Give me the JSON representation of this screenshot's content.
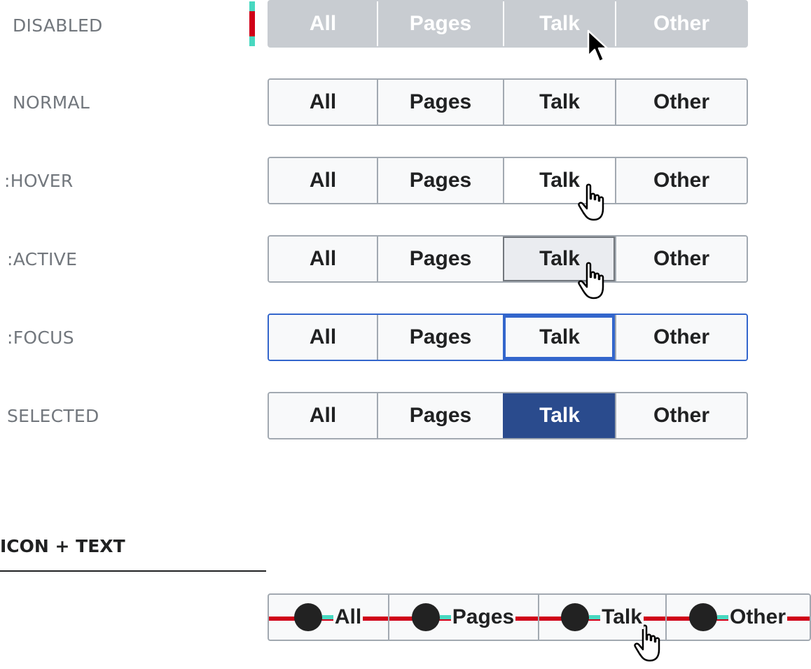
{
  "segments": [
    "All",
    "Pages",
    "Talk",
    "Other"
  ],
  "states": {
    "disabled": "DISABLED",
    "normal": "NORMAL",
    "hover": ":HOVER",
    "active": ":ACTIVE",
    "focus": ":FOCUS",
    "selected": "SELECTED"
  },
  "icon_section": {
    "title": "ICON + TEXT",
    "icon": "circle-icon"
  },
  "colors": {
    "border": "#a2a9b1",
    "focus_blue": "#3366cc",
    "selected_blue": "#2a4b8d",
    "disabled_gray": "#c8ccd1",
    "indicator_teal": "#48d8c0",
    "indicator_red": "#d00018"
  },
  "cursors": [
    "arrow-cursor-icon",
    "hand-cursor-icon"
  ]
}
